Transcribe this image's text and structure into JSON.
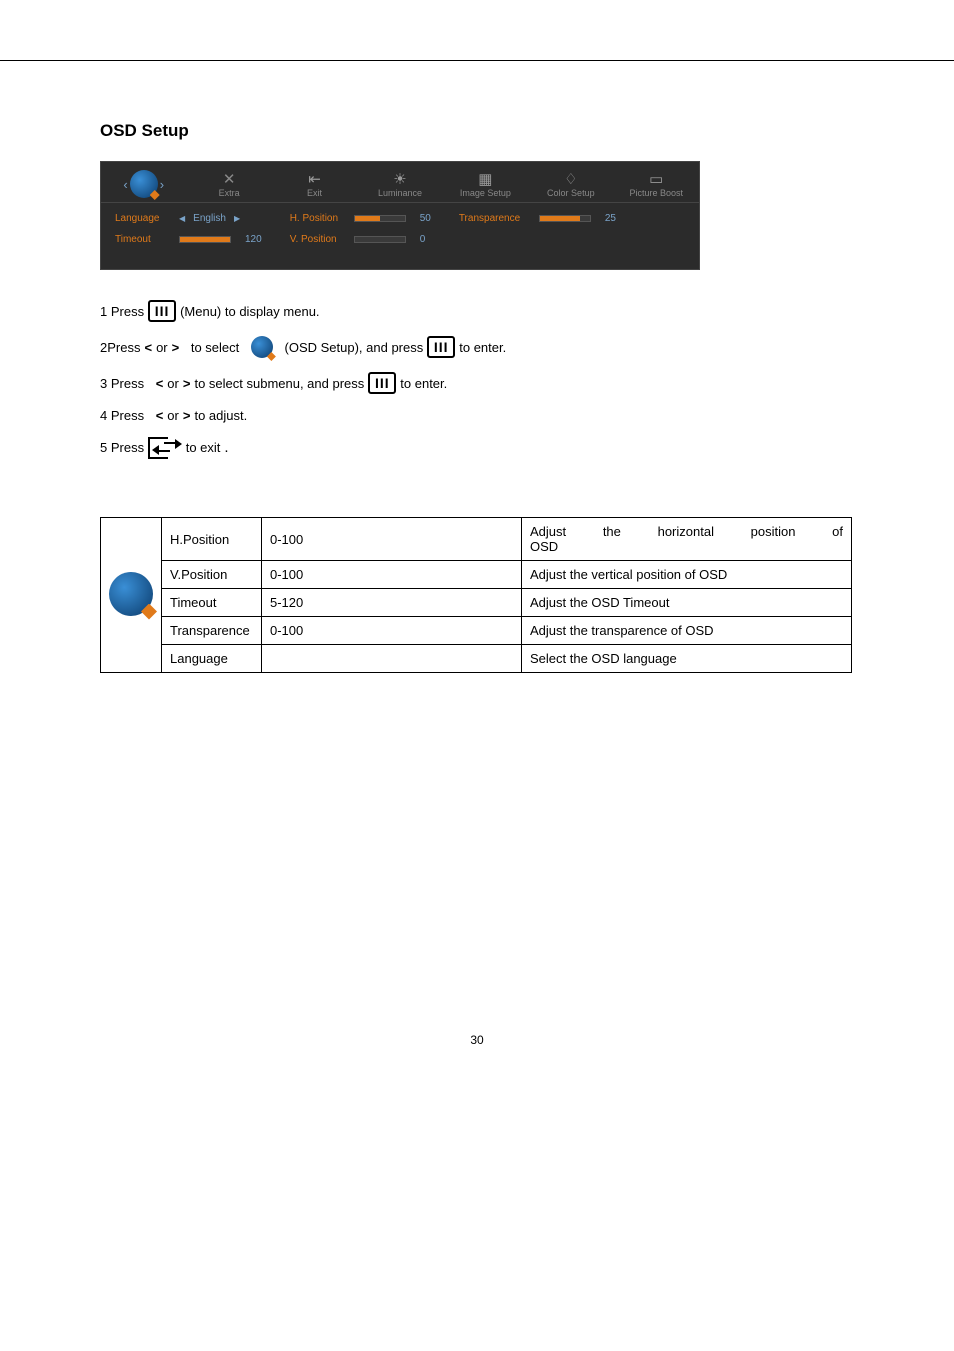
{
  "title": "OSD Setup",
  "osd": {
    "tabs": [
      "Extra",
      "Exit",
      "Luminance",
      "Image Setup",
      "Color Setup",
      "Picture Boost"
    ],
    "rows": {
      "language_label": "Language",
      "language_value": "English",
      "timeout_label": "Timeout",
      "timeout_value": "120",
      "hpos_label": "H. Position",
      "hpos_value": "50",
      "vpos_label": "V. Position",
      "vpos_value": "0",
      "trans_label": "Transparence",
      "trans_value": "25"
    }
  },
  "steps": {
    "s1a": "1 Press",
    "s1b": "(Menu) to display menu.",
    "s2a": "2Press",
    "s2b": "or",
    "s2c": "to select",
    "s2d": "(OSD Setup), and press",
    "s2e": "to enter.",
    "s3a": "3 Press",
    "s3b": "or",
    "s3c": "to select submenu, and press",
    "s3d": "to enter.",
    "s4a": "4 Press",
    "s4b": "or",
    "s4c": "to adjust.",
    "s5a": "5 Press",
    "s5b": "to exit",
    "lt": "<",
    "gt": ">"
  },
  "table": {
    "rows": [
      {
        "name": "H.Position",
        "range": "0-100",
        "desc": "Adjust the horizontal position of OSD"
      },
      {
        "name": "V.Position",
        "range": "0-100",
        "desc": "Adjust the vertical position of OSD"
      },
      {
        "name": "Timeout",
        "range": "5-120",
        "desc": "Adjust the OSD Timeout"
      },
      {
        "name": "Transparence",
        "range": "0-100",
        "desc": "Adjust the transparence of OSD"
      },
      {
        "name": "Language",
        "range": "",
        "desc": "Select the OSD language"
      }
    ]
  },
  "page_number": "30"
}
